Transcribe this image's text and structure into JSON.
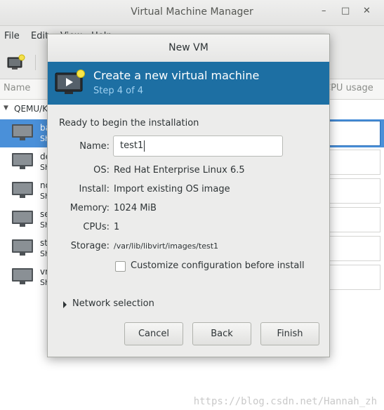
{
  "background_window": {
    "title": "Virtual Machine Manager",
    "controls": [
      "–",
      "□",
      "✕"
    ],
    "menu": [
      "File",
      "Edit",
      "View",
      "Help"
    ],
    "columns": {
      "name": "Name",
      "usage": "CPU usage"
    },
    "group_label": "QEMU/KVM",
    "vms": [
      {
        "name": "base",
        "state": "Shutoff",
        "selected": true
      },
      {
        "name": "demo",
        "state": "Shutoff",
        "selected": false
      },
      {
        "name": "node",
        "state": "Shutoff",
        "selected": false
      },
      {
        "name": "server",
        "state": "Shutoff",
        "selected": false
      },
      {
        "name": "storage",
        "state": "Shutoff",
        "selected": false
      },
      {
        "name": "vm",
        "state": "Shutoff",
        "selected": false
      }
    ]
  },
  "dialog": {
    "title": "New VM",
    "banner": {
      "title": "Create a new virtual machine",
      "step": "Step 4 of 4"
    },
    "ready_text": "Ready to begin the installation",
    "fields": {
      "name_label": "Name:",
      "name_value": "test1",
      "os_label": "OS:",
      "os_value": "Red Hat Enterprise Linux 6.5",
      "install_label": "Install:",
      "install_value": "Import existing OS image",
      "memory_label": "Memory:",
      "memory_value": "1024 MiB",
      "cpus_label": "CPUs:",
      "cpus_value": "1",
      "storage_label": "Storage:",
      "storage_value": "/var/lib/libvirt/images/test1"
    },
    "customize_label": "Customize configuration before install",
    "customize_checked": false,
    "network_label": "Network selection",
    "buttons": {
      "cancel": "Cancel",
      "back": "Back",
      "finish": "Finish"
    }
  },
  "watermark": "https://blog.csdn.net/Hannah_zh",
  "colors": {
    "banner": "#1d6fa3",
    "selection": "#4a90d9"
  }
}
